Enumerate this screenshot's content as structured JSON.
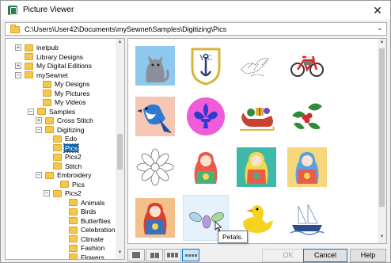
{
  "window": {
    "title": "Picture Viewer",
    "path": "C:\\Users\\User42\\Documents\\mySewnet\\Samples\\Digitizing\\Pics",
    "close_glyph": "✕",
    "dropdown_glyph": "⌄"
  },
  "tree": {
    "items": [
      {
        "label": "inetpub",
        "expander": "+"
      },
      {
        "label": "Library Designs",
        "expander": ""
      },
      {
        "label": "My Digital Editions",
        "expander": "+"
      },
      {
        "label": "mySewnet",
        "expander": "−"
      },
      {
        "label": "My Designs",
        "expander": ""
      },
      {
        "label": "My Pictures",
        "expander": ""
      },
      {
        "label": "My Videos",
        "expander": ""
      },
      {
        "label": "Samples",
        "expander": "−"
      },
      {
        "label": "Cross Stitch",
        "expander": "+"
      },
      {
        "label": "Digitizing",
        "expander": "−"
      },
      {
        "label": "Edo",
        "expander": ""
      },
      {
        "label": "Pics",
        "expander": ""
      },
      {
        "label": "Pics2",
        "expander": ""
      },
      {
        "label": "Stitch",
        "expander": ""
      },
      {
        "label": "Embroidery",
        "expander": "−"
      },
      {
        "label": "Pics",
        "expander": ""
      },
      {
        "label": "Pics2",
        "expander": "−"
      },
      {
        "label": "Animals",
        "expander": ""
      },
      {
        "label": "Birds",
        "expander": ""
      },
      {
        "label": "Butterflies",
        "expander": ""
      },
      {
        "label": "Celebration",
        "expander": ""
      },
      {
        "label": "Climate",
        "expander": ""
      },
      {
        "label": "Fashion",
        "expander": ""
      },
      {
        "label": "Flowers",
        "expander": ""
      }
    ],
    "selected": "Pics"
  },
  "thumbnails": [
    {
      "name": "cat"
    },
    {
      "name": "crest"
    },
    {
      "name": "lace-birds"
    },
    {
      "name": "bicycle"
    },
    {
      "name": "blue-jay"
    },
    {
      "name": "fleur-de-lis"
    },
    {
      "name": "sleigh"
    },
    {
      "name": "holly"
    },
    {
      "name": "flower-outline"
    },
    {
      "name": "matryoshka-1"
    },
    {
      "name": "matryoshka-2"
    },
    {
      "name": "matryoshka-3"
    },
    {
      "name": "matryoshka-4"
    },
    {
      "name": "petals"
    },
    {
      "name": "duck"
    },
    {
      "name": "ship"
    }
  ],
  "tooltip": "Petals.",
  "buttons": {
    "ok": "OK",
    "cancel": "Cancel",
    "help": "Help"
  }
}
